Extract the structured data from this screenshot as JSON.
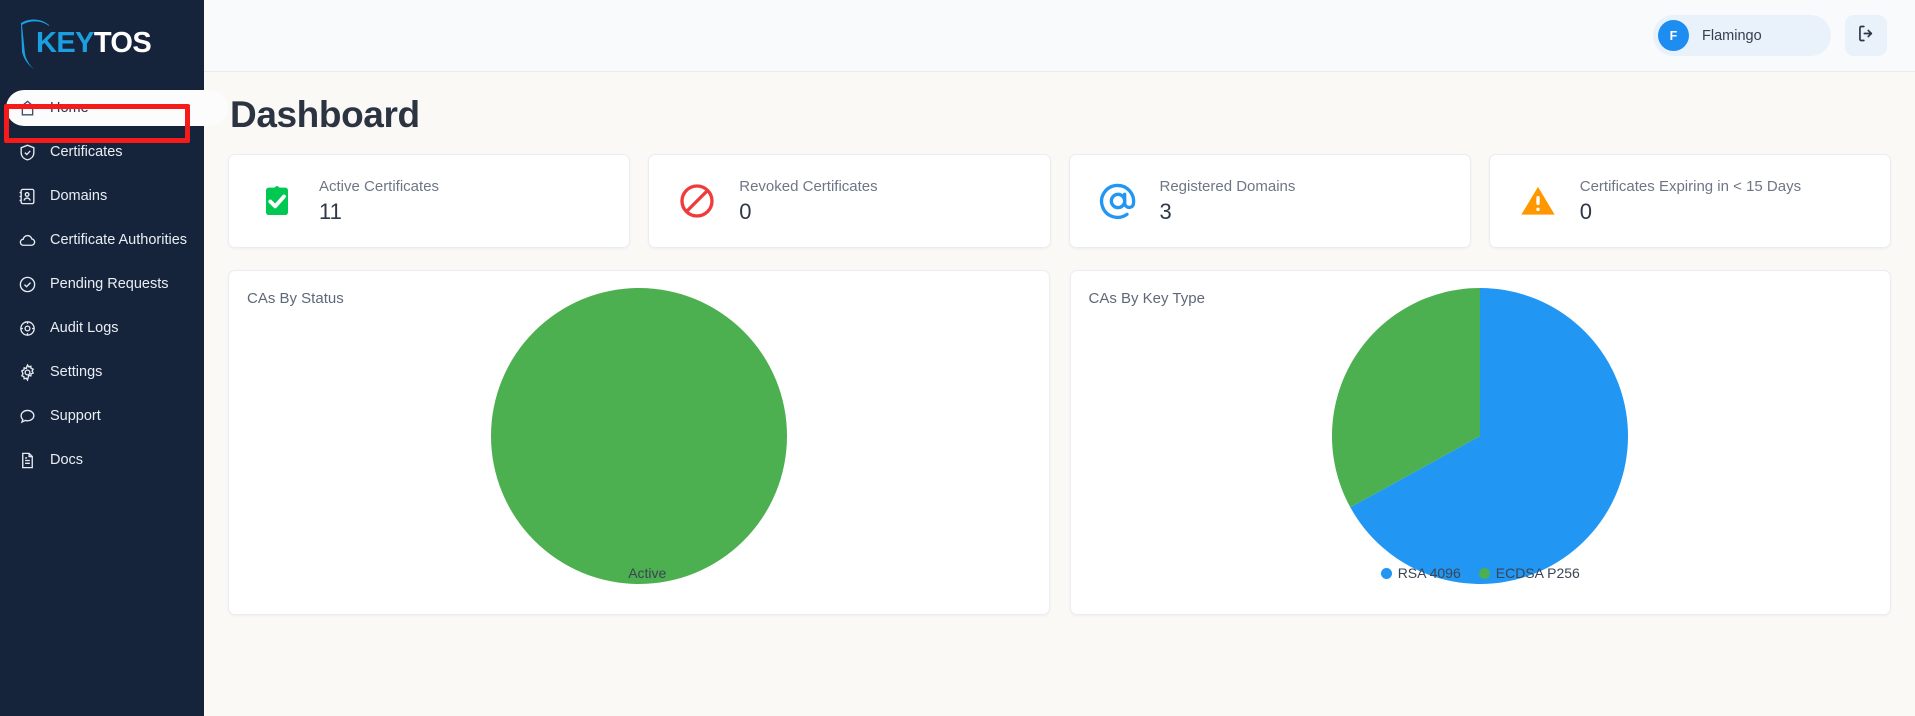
{
  "brand": {
    "name_part1": "KEY",
    "name_part2": "TOS",
    "logo_icon": "shield-icon"
  },
  "sidebar": {
    "items": [
      {
        "label": "Home",
        "icon": "home-icon",
        "active": true
      },
      {
        "label": "Certificates",
        "icon": "shield-check-icon",
        "active": false
      },
      {
        "label": "Domains",
        "icon": "contact-card-icon",
        "active": false
      },
      {
        "label": "Certificate Authorities",
        "icon": "cloud-icon",
        "active": false
      },
      {
        "label": "Pending Requests",
        "icon": "check-circle-icon",
        "active": false
      },
      {
        "label": "Audit Logs",
        "icon": "compass-icon",
        "active": false
      },
      {
        "label": "Settings",
        "icon": "gear-icon",
        "active": false
      },
      {
        "label": "Support",
        "icon": "chat-bubble-icon",
        "active": false
      },
      {
        "label": "Docs",
        "icon": "document-icon",
        "active": false
      }
    ],
    "highlight": {
      "target_label": "Certificates",
      "color": "#f51b1b"
    }
  },
  "topbar": {
    "user": {
      "initial": "F",
      "name": "Flamingo"
    },
    "logout_icon": "logout-icon"
  },
  "main": {
    "page_title": "Dashboard",
    "stats": [
      {
        "label": "Active Certificates",
        "value": "11",
        "icon": "clipboard-check-icon",
        "color": "#00c853"
      },
      {
        "label": "Revoked Certificates",
        "value": "0",
        "icon": "no-entry-icon",
        "color": "#ef3b3b"
      },
      {
        "label": "Registered Domains",
        "value": "3",
        "icon": "at-sign-icon",
        "color": "#2196f3"
      },
      {
        "label": "Certificates Expiring in < 15 Days",
        "value": "0",
        "icon": "warning-triangle-icon",
        "color": "#ff9800"
      }
    ],
    "charts": [
      {
        "title": "CAs By Status"
      },
      {
        "title": "CAs By Key Type"
      }
    ]
  },
  "chart_data": [
    {
      "type": "pie",
      "title": "CAs By Status",
      "labels": [
        "Active"
      ],
      "values": [
        100
      ],
      "colors": [
        "#4caf50"
      ],
      "legend_position": "bottom",
      "legend": [
        {
          "label": "Active",
          "color": "#4caf50"
        }
      ]
    },
    {
      "type": "pie",
      "title": "CAs By Key Type",
      "labels": [
        "RSA 4096",
        "ECDSA P256"
      ],
      "values": [
        67,
        33
      ],
      "colors": [
        "#2196f3",
        "#4caf50"
      ],
      "legend_position": "bottom",
      "legend": [
        {
          "label": "RSA 4096",
          "color": "#2196f3"
        },
        {
          "label": "ECDSA P256",
          "color": "#4caf50"
        }
      ]
    }
  ]
}
